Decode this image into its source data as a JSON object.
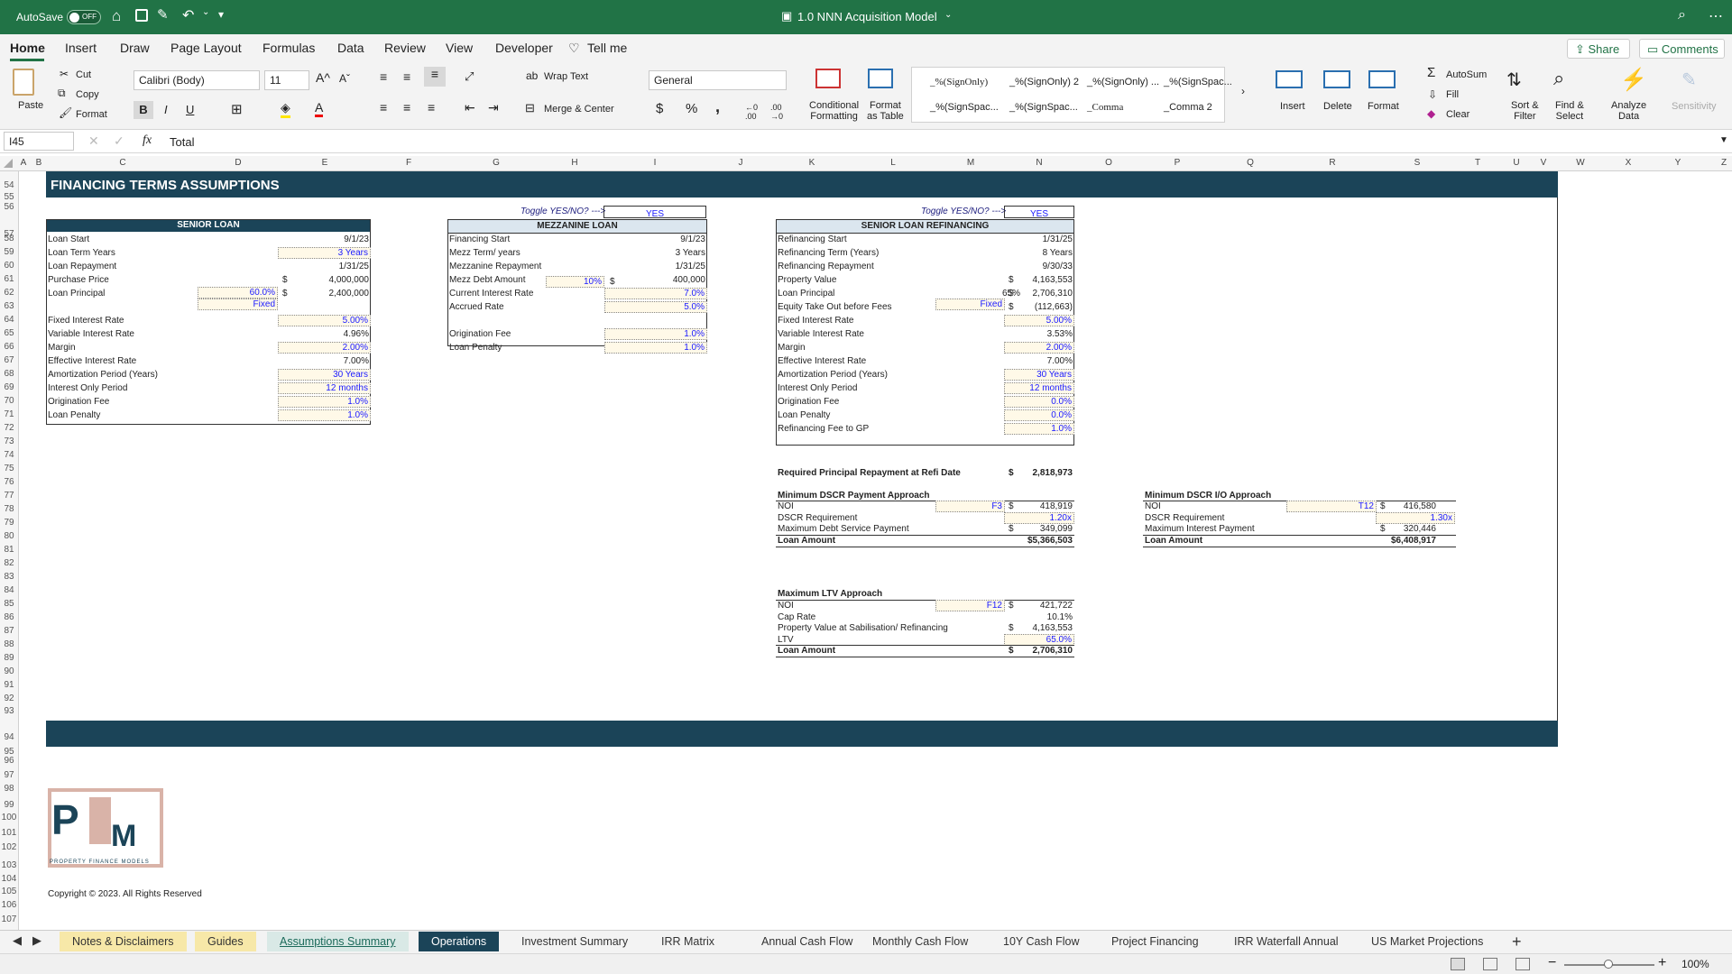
{
  "titlebar": {
    "autosave": "AutoSave",
    "autosave_state": "OFF",
    "title": "1.0 NNN Acquisition Model"
  },
  "ribbon_tabs": [
    "Home",
    "Insert",
    "Draw",
    "Page Layout",
    "Formulas",
    "Data",
    "Review",
    "View",
    "Developer",
    "Tell me"
  ],
  "share": "Share",
  "comments": "Comments",
  "ribbon": {
    "paste": "Paste",
    "cut": "Cut",
    "copy": "Copy",
    "format": "Format",
    "font": "Calibri (Body)",
    "size": "11",
    "bold": "B",
    "italic": "I",
    "underline": "U",
    "wrap": "Wrap Text",
    "merge": "Merge & Center",
    "number_format": "General",
    "currency": "$",
    "percent": "%",
    "comma": ",",
    "cond_fmt": "Conditional\nFormatting",
    "fmt_table": "Format\nas Table",
    "styles": [
      "_%(SignOnly)",
      "_%(SignOnly) 2",
      "_%(SignOnly) ...",
      "_%(SignSpac...",
      "_%(SignSpac...",
      "_%(SignSpac...",
      "_Comma",
      "_Comma 2"
    ],
    "insert": "Insert",
    "delete": "Delete",
    "format2": "Format",
    "autosum": "AutoSum",
    "fill": "Fill",
    "clear": "Clear",
    "sort": "Sort &\nFilter",
    "find": "Find &\nSelect",
    "analyze": "Analyze\nData",
    "sensitivity": "Sensitivity"
  },
  "formula": {
    "cell": "I45",
    "fx": "fx",
    "value": "Total"
  },
  "columns": [
    [
      "A",
      26
    ],
    [
      "B",
      43
    ],
    [
      "C",
      136
    ],
    [
      "D",
      264
    ],
    [
      "E",
      360
    ],
    [
      "F",
      453
    ],
    [
      "G",
      550
    ],
    [
      "H",
      637
    ],
    [
      "I",
      726
    ],
    [
      "J",
      821
    ],
    [
      "K",
      900
    ],
    [
      "L",
      990
    ],
    [
      "M",
      1076
    ],
    [
      "N",
      1152
    ],
    [
      "O",
      1229
    ],
    [
      "P",
      1305
    ],
    [
      "Q",
      1386
    ],
    [
      "R",
      1477
    ],
    [
      "S",
      1571
    ],
    [
      "T",
      1638
    ],
    [
      "U",
      1681
    ],
    [
      "V",
      1711
    ],
    [
      "W",
      1752
    ],
    [
      "X",
      1805
    ],
    [
      "Y",
      1860
    ],
    [
      "Z",
      1911
    ]
  ],
  "rows": [
    "54",
    "55",
    "56",
    "57",
    "58",
    "59",
    "60",
    "61",
    "62",
    "63",
    "64",
    "65",
    "66",
    "67",
    "68",
    "69",
    "70",
    "71",
    "72",
    "73",
    "74",
    "75",
    "76",
    "77",
    "78",
    "79",
    "80",
    "81",
    "82",
    "83",
    "84",
    "85",
    "86",
    "87",
    "88",
    "89",
    "90",
    "91",
    "92",
    "93",
    "94",
    "95",
    "96",
    "97",
    "98",
    "99",
    "100",
    "101",
    "102",
    "103",
    "104",
    "105",
    "106",
    "107"
  ],
  "section_title": "FINANCING TERMS ASSUMPTIONS",
  "senior": {
    "header": "SENIOR LOAN",
    "rows": [
      [
        "Loan Start",
        "",
        "9/1/23",
        false
      ],
      [
        "Loan Term Years",
        "",
        "3 Years",
        true
      ],
      [
        "Loan Repayment",
        "",
        "1/31/25",
        false
      ],
      [
        "Purchase Price",
        "$",
        "4,000,000",
        false
      ],
      [
        "Loan Principal",
        "$",
        "2,400,000",
        false
      ],
      [
        "Fixed Interest Rate",
        "",
        "5.00%",
        true
      ],
      [
        "Variable Interest Rate",
        "",
        "4.96%",
        false
      ],
      [
        "Margin",
        "",
        "2.00%",
        true
      ],
      [
        "Effective Interest Rate",
        "",
        "7.00%",
        false
      ],
      [
        "Amortization Period (Years)",
        "",
        "30 Years",
        true
      ],
      [
        "Interest Only Period",
        "",
        "12 months",
        true
      ],
      [
        "Origination Fee",
        "",
        "1.0%",
        true
      ],
      [
        "Loan Penalty",
        "",
        "1.0%",
        true
      ]
    ],
    "ltv": "60.0%",
    "rate_type": "Fixed"
  },
  "mezz": {
    "toggle": "Toggle YES/NO? --->",
    "toggle_val": "YES",
    "header": "MEZZANINE LOAN",
    "rows": [
      [
        "Financing Start",
        "9/1/23",
        false
      ],
      [
        "Mezz Term/ years",
        "3 Years",
        false
      ],
      [
        "Mezzanine Repayment",
        "1/31/25",
        false
      ],
      [
        "Mezz Debt Amount",
        "400,000",
        false
      ],
      [
        "Current Interest Rate",
        "7.0%",
        true
      ],
      [
        "Accrued Rate",
        "5.0%",
        true
      ],
      [
        "Origination Fee",
        "1.0%",
        true
      ],
      [
        "Loan Penalty",
        "1.0%",
        true
      ]
    ],
    "pct": "10%",
    "dollar": "$"
  },
  "refi": {
    "toggle": "Toggle YES/NO? --->",
    "toggle_val": "YES",
    "header": "SENIOR LOAN REFINANCING",
    "rows": [
      [
        "Refinancing Start",
        "",
        "1/31/25",
        false
      ],
      [
        "Refinancing Term (Years)",
        "",
        "8 Years",
        false
      ],
      [
        "Refinancing Repayment",
        "",
        "9/30/33",
        false
      ],
      [
        "Property Value",
        "$",
        "4,163,553",
        false
      ],
      [
        "Loan Principal",
        "$",
        "2,706,310",
        false
      ],
      [
        "Equity Take Out before Fees",
        "$",
        "(112,663)",
        false
      ],
      [
        "Fixed Interest Rate",
        "",
        "5.00%",
        true
      ],
      [
        "Variable Interest Rate",
        "",
        "3.53%",
        false
      ],
      [
        "Margin",
        "",
        "2.00%",
        true
      ],
      [
        "Effective Interest Rate",
        "",
        "7.00%",
        false
      ],
      [
        "Amortization Period (Years)",
        "",
        "30 Years",
        true
      ],
      [
        "Interest Only Period",
        "",
        "12 months",
        true
      ],
      [
        "Origination Fee",
        "",
        "0.0%",
        true
      ],
      [
        "Loan Penalty",
        "",
        "0.0%",
        true
      ],
      [
        "Refinancing Fee to GP",
        "",
        "1.0%",
        true
      ]
    ],
    "ltv": "65%",
    "rate_type": "Fixed"
  },
  "req": {
    "label": "Required Principal Repayment at Refi Date",
    "dollar": "$",
    "value": "2,818,973"
  },
  "dscr": {
    "title": "Minimum DSCR Payment Approach",
    "noi": "NOI",
    "noi_ref": "F3",
    "noi_d": "$",
    "noi_v": "418,919",
    "req": "DSCR Requirement",
    "req_v": "1.20x",
    "max": "Maximum Debt Service Payment",
    "max_d": "$",
    "max_v": "349,099",
    "loan": "Loan Amount",
    "loan_v": "$5,366,503"
  },
  "dscrio": {
    "title": "Minimum DSCR I/O Approach",
    "noi": "NOI",
    "noi_ref": "T12",
    "noi_d": "$",
    "noi_v": "416,580",
    "req": "DSCR Requirement",
    "req_v": "1.30x",
    "max": "Maximum Interest Payment",
    "max_d": "$",
    "max_v": "320,446",
    "loan": "Loan Amount",
    "loan_v": "$6,408,917"
  },
  "ltv": {
    "title": "Maximum LTV Approach",
    "noi": "NOI",
    "noi_ref": "F12",
    "noi_d": "$",
    "noi_v": "421,722",
    "cap": "Cap Rate",
    "cap_v": "10.1%",
    "pv": "Property Value at Sabilisation/ Refinancing",
    "pv_d": "$",
    "pv_v": "4,163,553",
    "ltv": "LTV",
    "ltv_v": "65.0%",
    "loan": "Loan Amount",
    "loan_d": "$",
    "loan_v": "2,706,310"
  },
  "logo": {
    "text": "PTM",
    "sub": "PROPERTY FINANCE MODELS"
  },
  "copyright": "Copyright © 2023. All Rights Reserved",
  "sheet_tabs": [
    "Notes & Disclaimers",
    "Guides",
    "Assumptions Summary",
    "Operations",
    "Investment Summary",
    "IRR Matrix",
    "Annual Cash Flow",
    "Monthly Cash Flow",
    "10Y Cash Flow",
    "Project Financing",
    "IRR Waterfall Annual",
    "US Market Projections"
  ],
  "zoom": "100%",
  "colors": {
    "excel_green": "#217346",
    "navy": "#1b4458",
    "input_blue": "#1a1aff"
  }
}
